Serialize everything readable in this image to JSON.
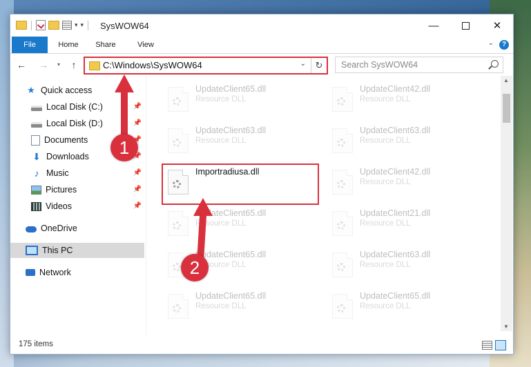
{
  "window": {
    "title": "SysWOW64",
    "min_glyph": "—",
    "close_glyph": "✕"
  },
  "ribbon": {
    "tabs": [
      "File",
      "Home",
      "Share",
      "View"
    ]
  },
  "navigation": {
    "address": "C:\\Windows\\SysWOW64",
    "search_placeholder": "Search SysWOW64"
  },
  "sidebar": {
    "items": [
      {
        "label": "Quick access",
        "icon": "star-icon",
        "pinned": false
      },
      {
        "label": "Local Disk (C:)",
        "icon": "disk-icon",
        "pinned": true
      },
      {
        "label": "Local Disk (D:)",
        "icon": "disk-icon",
        "pinned": true
      },
      {
        "label": "Documents",
        "icon": "documents-icon",
        "pinned": true
      },
      {
        "label": "Downloads",
        "icon": "download-icon",
        "pinned": true
      },
      {
        "label": "Music",
        "icon": "music-icon",
        "pinned": true
      },
      {
        "label": "Pictures",
        "icon": "pictures-icon",
        "pinned": true
      },
      {
        "label": "Videos",
        "icon": "videos-icon",
        "pinned": true
      },
      {
        "label": "OneDrive",
        "icon": "cloud-icon",
        "pinned": false
      },
      {
        "label": "This PC",
        "icon": "pc-icon",
        "pinned": false,
        "selected": true
      },
      {
        "label": "Network",
        "icon": "network-icon",
        "pinned": false
      }
    ]
  },
  "files": [
    {
      "name": "UpdateClient65.dll",
      "type": "Resource DLL",
      "faded": true
    },
    {
      "name": "UpdateClient42.dll",
      "type": "Resource DLL",
      "faded": true
    },
    {
      "name": "UpdateClient63.dll",
      "type": "Resource DLL",
      "faded": true
    },
    {
      "name": "UpdateClient63.dll",
      "type": "Resource DLL",
      "faded": true
    },
    {
      "name": "Importradiusa.dll",
      "type": "",
      "faded": false
    },
    {
      "name": "UpdateClient42.dll",
      "type": "Resource DLL",
      "faded": true
    },
    {
      "name": "UpdateClient65.dll",
      "type": "Resource DLL",
      "faded": true
    },
    {
      "name": "UpdateClient21.dll",
      "type": "Resource DLL",
      "faded": true
    },
    {
      "name": "UpdateClient65.dll",
      "type": "Resource DLL",
      "faded": true
    },
    {
      "name": "UpdateClient63.dll",
      "type": "Resource DLL",
      "faded": true
    },
    {
      "name": "UpdateClient65.dll",
      "type": "Resource DLL",
      "faded": true
    },
    {
      "name": "UpdateClient65.dll",
      "type": "Resource DLL",
      "faded": true
    }
  ],
  "status": {
    "item_count": "175 items"
  },
  "annotations": {
    "marker_1": "1",
    "marker_2": "2",
    "accent_color": "#d9303e"
  }
}
